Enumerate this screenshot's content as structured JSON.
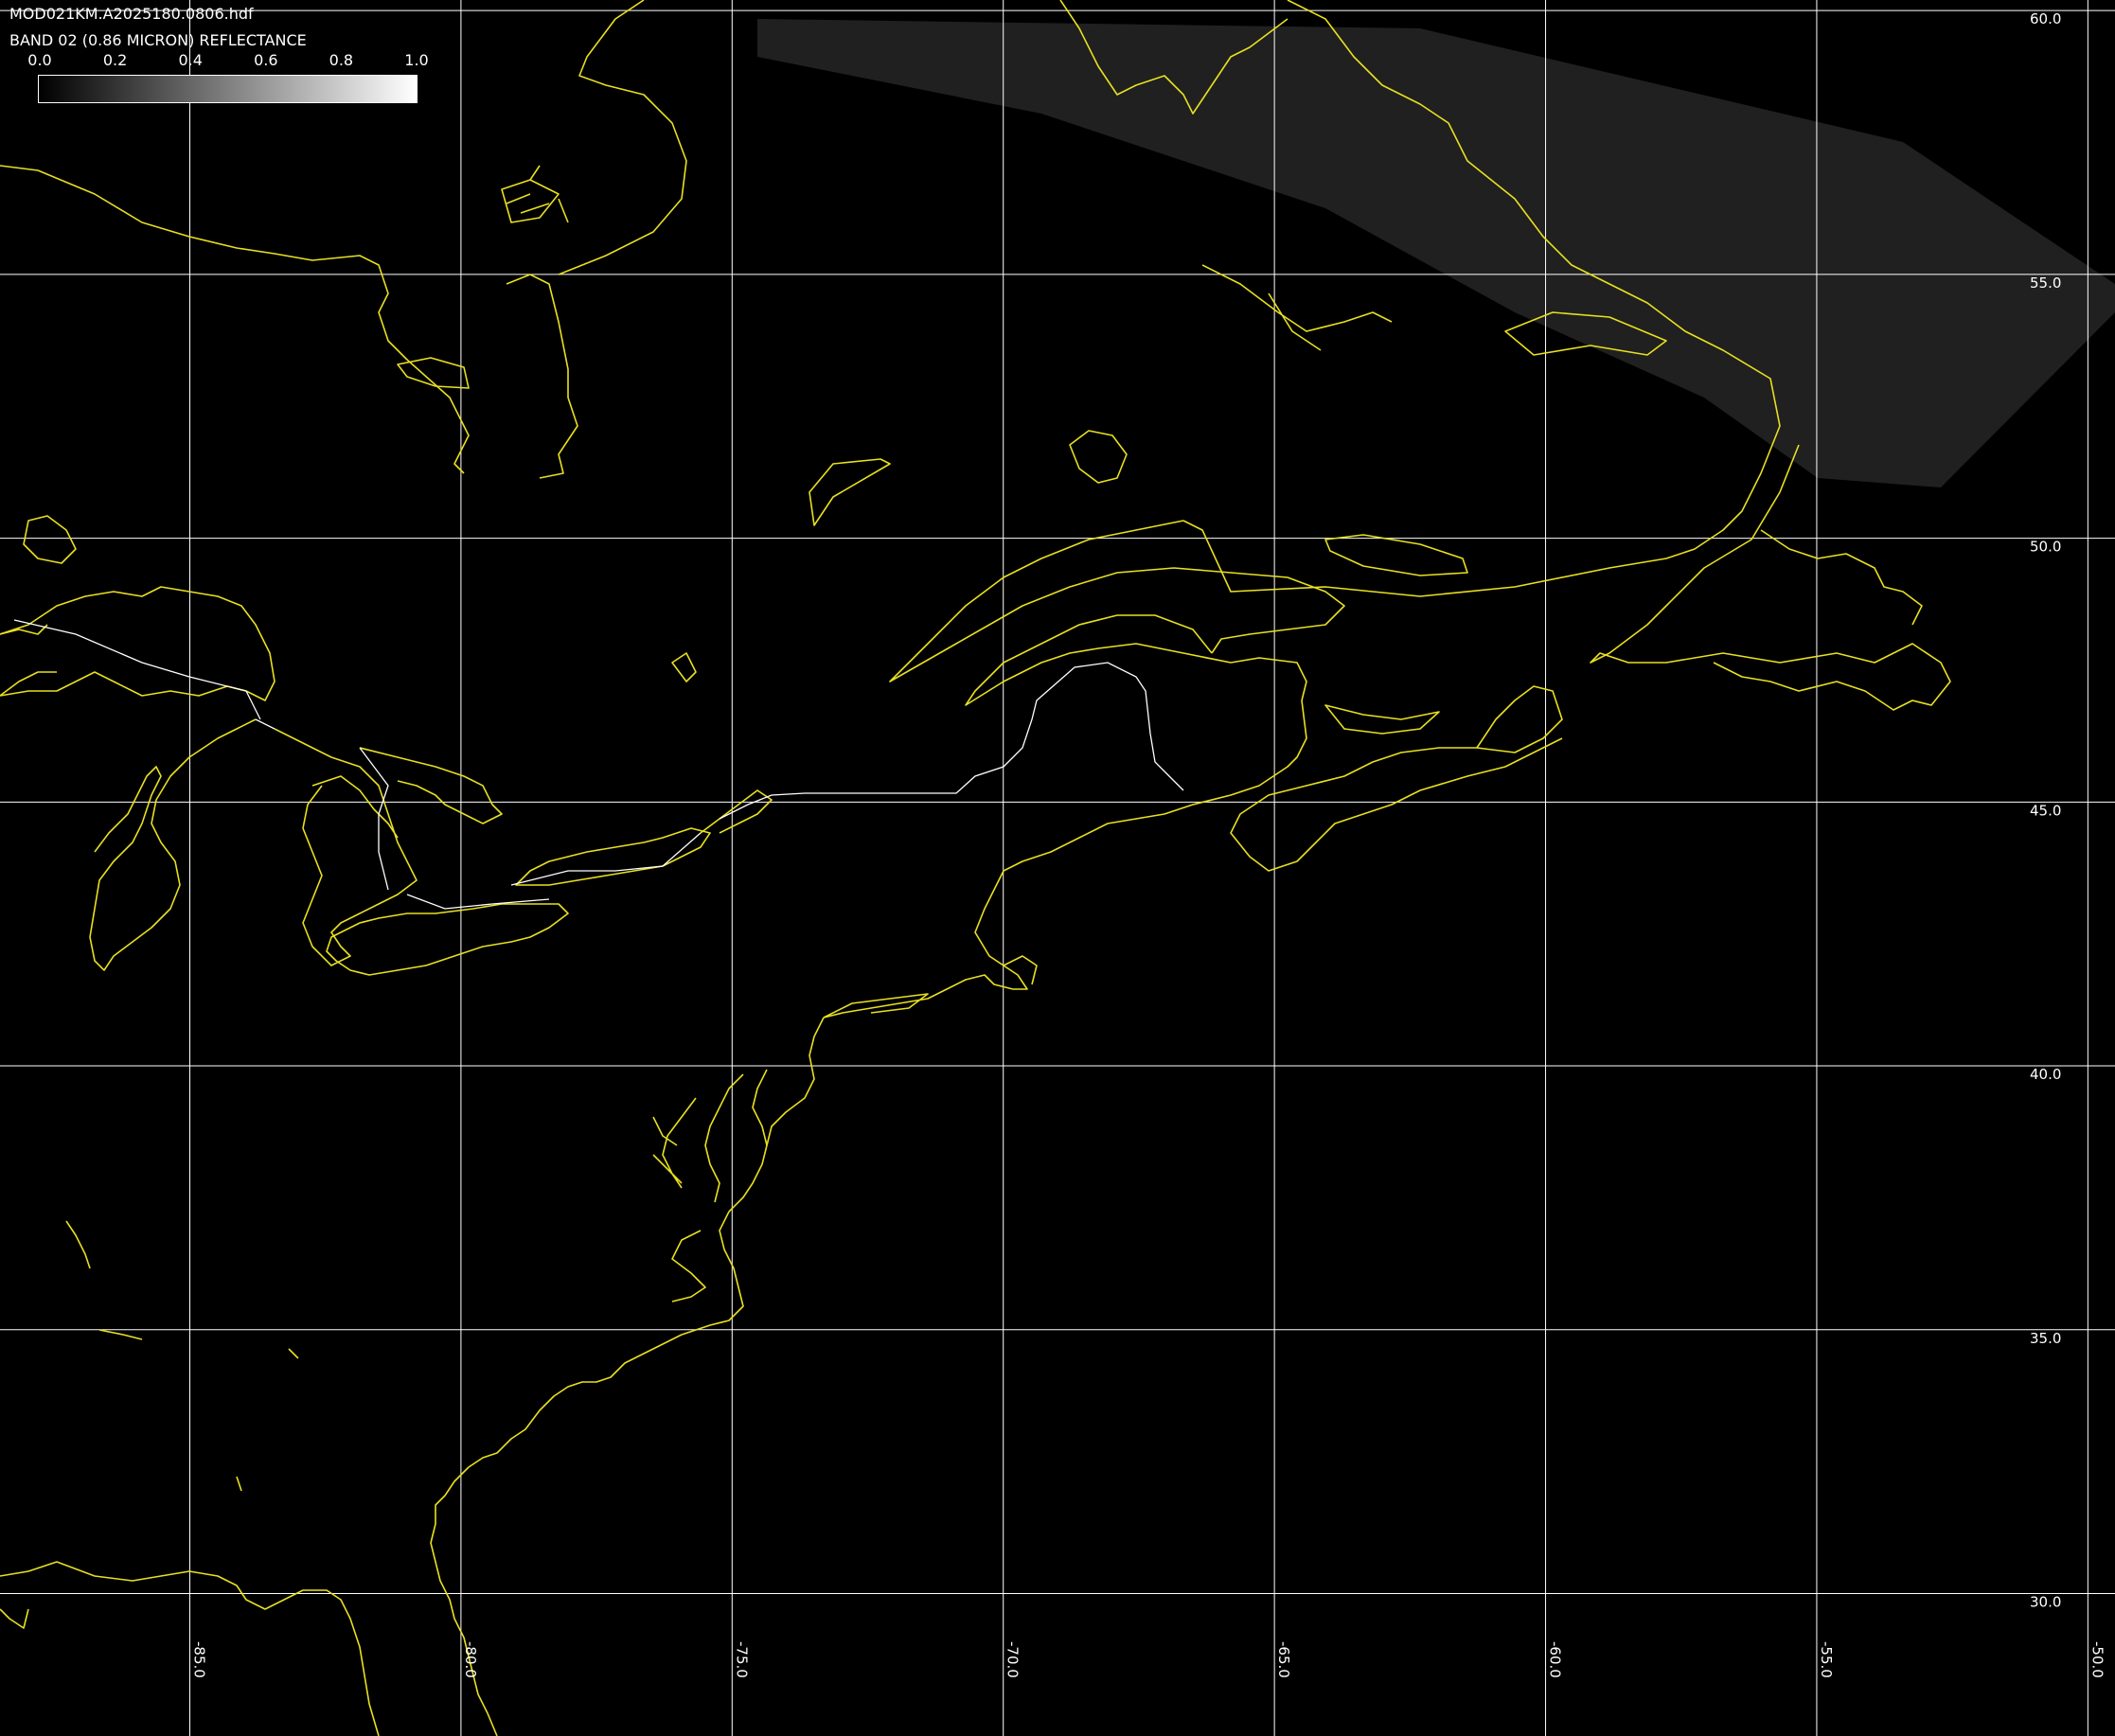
{
  "header": {
    "file_name": "MOD021KM.A2025180.0806.hdf",
    "band_label": "BAND 02 (0.86 MICRON) REFLECTANCE"
  },
  "colorbar": {
    "ticks": [
      "0.0",
      "0.2",
      "0.4",
      "0.6",
      "0.8",
      "1.0"
    ],
    "from_color": "#000000",
    "to_color": "#ffffff"
  },
  "map": {
    "background": "#000000",
    "coastline_color": "#e8e020",
    "border_color": "#ffffff",
    "grid_color": "#ffffff",
    "lon_range": [
      -88.5,
      -49.5
    ],
    "lat_range": [
      27.3,
      60.2
    ],
    "longitudes": [
      {
        "value": -85,
        "label": "-85.0"
      },
      {
        "value": -80,
        "label": "-80.0"
      },
      {
        "value": -75,
        "label": "-75.0"
      },
      {
        "value": -70,
        "label": "-70.0"
      },
      {
        "value": -65,
        "label": "-65.0"
      },
      {
        "value": -60,
        "label": "-60.0"
      },
      {
        "value": -55,
        "label": "-55.0"
      },
      {
        "value": -50,
        "label": "-50.0"
      }
    ],
    "latitudes": [
      {
        "value": 60,
        "label": "60.0"
      },
      {
        "value": 55,
        "label": "55.0"
      },
      {
        "value": 50,
        "label": "50.0"
      },
      {
        "value": 45,
        "label": "45.0"
      },
      {
        "value": 40,
        "label": "40.0"
      },
      {
        "value": 35,
        "label": "35.0"
      },
      {
        "value": 30,
        "label": "30.0"
      }
    ]
  }
}
